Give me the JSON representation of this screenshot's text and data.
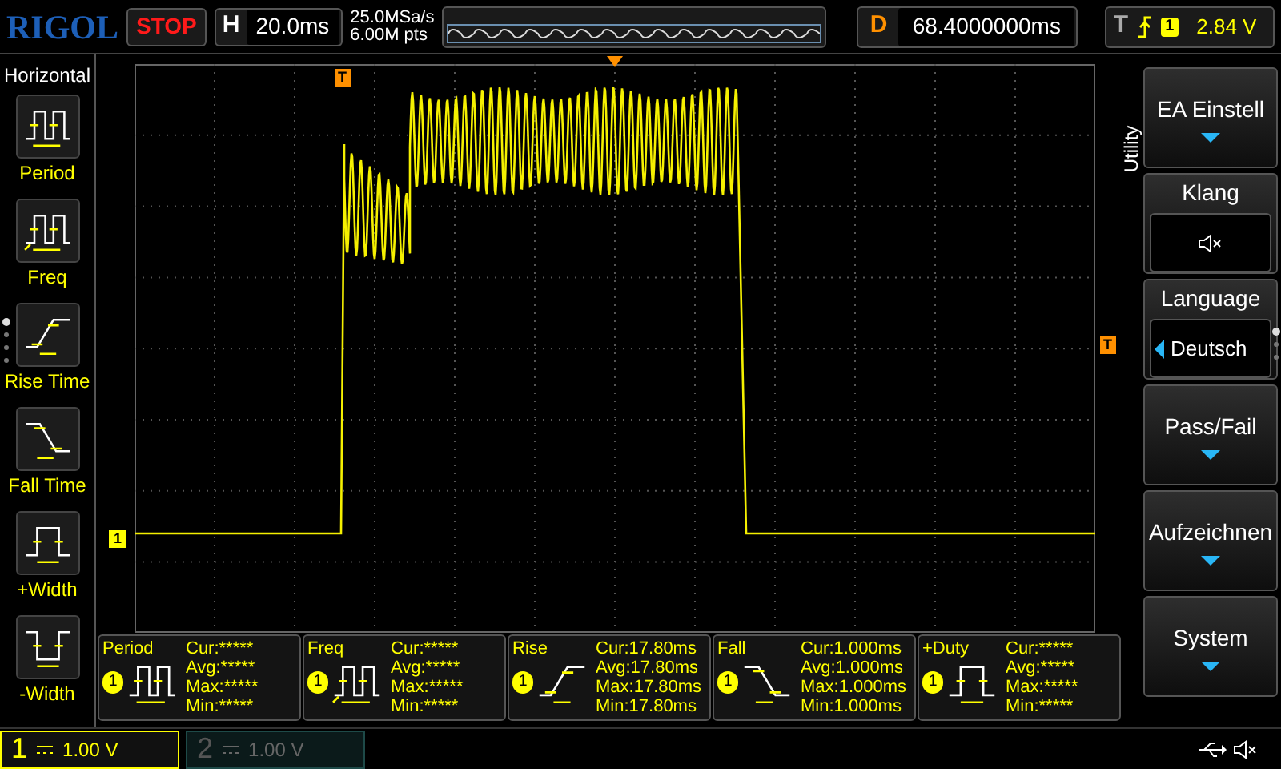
{
  "header": {
    "logo": "RIGOL",
    "run_state": "STOP",
    "timebase_label": "H",
    "timebase": "20.0ms",
    "sample_rate": "25.0MSa/s",
    "memory_depth": "6.00M pts",
    "delay_label": "D",
    "delay": "68.4000000ms",
    "trigger_label": "T",
    "trigger_channel": "1",
    "trigger_level": "2.84 V"
  },
  "left_menu": {
    "title": "Horizontal",
    "items": [
      {
        "kind": "period",
        "label": "Period"
      },
      {
        "kind": "freq",
        "label": "Freq"
      },
      {
        "kind": "rise",
        "label": "Rise Time"
      },
      {
        "kind": "fall",
        "label": "Fall Time"
      },
      {
        "kind": "pwidth",
        "label": "+Width"
      },
      {
        "kind": "nwidth",
        "label": "-Width"
      }
    ]
  },
  "scope": {
    "trigger_marker": "T",
    "channel_marker": "1",
    "level_marker": "T"
  },
  "right_menu": {
    "title": "Utility",
    "items": [
      {
        "kind": "submenu",
        "label": "EA Einstell"
      },
      {
        "kind": "sound",
        "label": "Klang",
        "muted": true
      },
      {
        "kind": "choice",
        "label": "Language",
        "value": "Deutsch"
      },
      {
        "kind": "submenu",
        "label": "Pass/Fail"
      },
      {
        "kind": "submenu",
        "label": "Aufzeichnen"
      },
      {
        "kind": "submenu",
        "label": "System"
      }
    ]
  },
  "measurements": [
    {
      "kind": "period",
      "label": "Period",
      "channel": "1",
      "cur": "Cur:*****",
      "avg": "Avg:*****",
      "max": "Max:*****",
      "min": "Min:*****"
    },
    {
      "kind": "freq",
      "label": "Freq",
      "channel": "1",
      "cur": "Cur:*****",
      "avg": "Avg:*****",
      "max": "Max:*****",
      "min": "Min:*****"
    },
    {
      "kind": "rise",
      "label": "Rise",
      "channel": "1",
      "cur": "Cur:17.80ms",
      "avg": "Avg:17.80ms",
      "max": "Max:17.80ms",
      "min": "Min:17.80ms"
    },
    {
      "kind": "fall",
      "label": "Fall",
      "channel": "1",
      "cur": "Cur:1.000ms",
      "avg": "Avg:1.000ms",
      "max": "Max:1.000ms",
      "min": "Min:1.000ms"
    },
    {
      "kind": "pwidth",
      "label": "+Duty",
      "channel": "1",
      "cur": "Cur:*****",
      "avg": "Avg:*****",
      "max": "Max:*****",
      "min": "Min:*****"
    }
  ],
  "channels": [
    {
      "number": "1",
      "scale": "1.00 V",
      "on": true
    },
    {
      "number": "2",
      "scale": "1.00 V",
      "on": false
    }
  ]
}
